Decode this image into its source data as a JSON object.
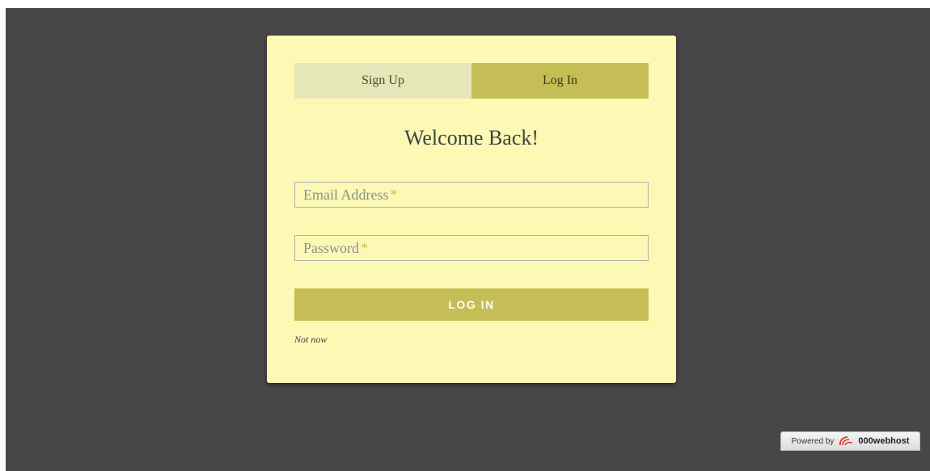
{
  "tabs": {
    "signup_label": "Sign Up",
    "login_label": "Log In",
    "active": "login"
  },
  "heading": "Welcome Back!",
  "form": {
    "email_placeholder": "Email Address",
    "password_placeholder": "Password",
    "required_marker": "*",
    "submit_label": "LOG IN",
    "not_now_label": "Not now"
  },
  "footer": {
    "powered_by_label": "Powered by",
    "brand_name": "000webhost",
    "logo_icon": "000webhost-logo-icon"
  },
  "colors": {
    "page_background": "#474747",
    "card_background": "#fdf8b4",
    "accent": "#c5bd55",
    "inactive_tab": "#e6e7b8",
    "required_marker": "#c5bd55"
  }
}
